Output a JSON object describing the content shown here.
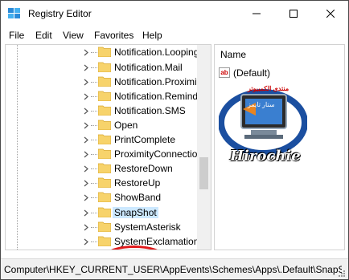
{
  "window": {
    "title": "Registry Editor"
  },
  "menu": [
    "File",
    "Edit",
    "View",
    "Favorites",
    "Help"
  ],
  "tree": {
    "items": [
      {
        "label": "Notification.Looping"
      },
      {
        "label": "Notification.Mail"
      },
      {
        "label": "Notification.Proximity"
      },
      {
        "label": "Notification.Reminder"
      },
      {
        "label": "Notification.SMS"
      },
      {
        "label": "Open"
      },
      {
        "label": "PrintComplete"
      },
      {
        "label": "ProximityConnection"
      },
      {
        "label": "RestoreDown"
      },
      {
        "label": "RestoreUp"
      },
      {
        "label": "ShowBand"
      },
      {
        "label": "SnapShot",
        "selected": true
      },
      {
        "label": "SystemAsterisk"
      },
      {
        "label": "SystemExclamation"
      }
    ]
  },
  "values": {
    "column_name": "Name",
    "rows": [
      {
        "name": "(Default)",
        "icon": "string-value-icon"
      }
    ]
  },
  "watermark": {
    "brand": "Hirochie",
    "line1": "منتدى الكمبيوتر",
    "line2": "ستار تايمز"
  },
  "status": {
    "path": "Computer\\HKEY_CURRENT_USER\\AppEvents\\Schemes\\Apps\\.Default\\SnapShot"
  },
  "colors": {
    "highlight": "#e0191b",
    "folder": "#f7d36b",
    "selected": "#cce8ff"
  }
}
